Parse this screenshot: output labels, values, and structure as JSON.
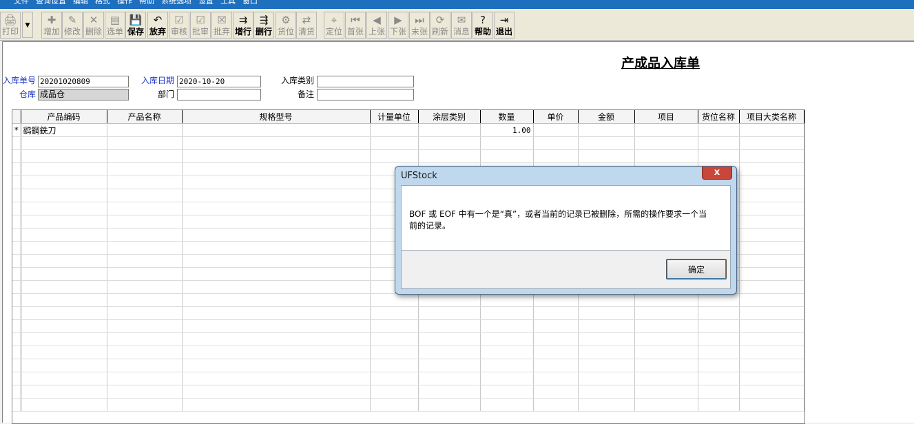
{
  "menubar": {
    "items": [
      "文件",
      "查询设置",
      "编辑",
      "格式",
      "操作",
      "帮助",
      "系统选项",
      "设置",
      "工具",
      "窗口"
    ]
  },
  "toolbar": {
    "buttons": [
      {
        "label": "打印",
        "icon": "🖨",
        "enabled": false
      },
      {
        "label": "增加",
        "icon": "✚",
        "enabled": false
      },
      {
        "label": "修改",
        "icon": "✎",
        "enabled": false
      },
      {
        "label": "删除",
        "icon": "✕",
        "enabled": false
      },
      {
        "label": "选单",
        "icon": "▤",
        "enabled": false
      },
      {
        "label": "保存",
        "icon": "💾",
        "enabled": true
      },
      {
        "label": "放弃",
        "icon": "↶",
        "enabled": true
      },
      {
        "label": "审核",
        "icon": "☑",
        "enabled": false
      },
      {
        "label": "批审",
        "icon": "☑",
        "enabled": false
      },
      {
        "label": "批弃",
        "icon": "☒",
        "enabled": false
      },
      {
        "label": "增行",
        "icon": "⇉",
        "enabled": true
      },
      {
        "label": "删行",
        "icon": "⇶",
        "enabled": true
      },
      {
        "label": "货位",
        "icon": "⚙",
        "enabled": false
      },
      {
        "label": "清货",
        "icon": "⇄",
        "enabled": false
      },
      {
        "label": "定位",
        "icon": "⌖",
        "enabled": false
      },
      {
        "label": "首张",
        "icon": "⏮",
        "enabled": false
      },
      {
        "label": "上张",
        "icon": "◀",
        "enabled": false
      },
      {
        "label": "下张",
        "icon": "▶",
        "enabled": false
      },
      {
        "label": "末张",
        "icon": "⏭",
        "enabled": false
      },
      {
        "label": "刷新",
        "icon": "⟳",
        "enabled": false
      },
      {
        "label": "消息",
        "icon": "✉",
        "enabled": false
      },
      {
        "label": "帮助",
        "icon": "?",
        "enabled": true
      },
      {
        "label": "退出",
        "icon": "⇥",
        "enabled": true
      }
    ]
  },
  "form": {
    "title": "产成品入库单",
    "receipt_no_label": "入库单号",
    "receipt_no": "20201020809",
    "date_label": "入库日期",
    "date": "2020-10-20",
    "category_label": "入库类别",
    "category": "",
    "warehouse_label": "仓库",
    "warehouse": "成品仓",
    "department_label": "部门",
    "department": "",
    "remark_label": "备注",
    "remark": ""
  },
  "grid": {
    "columns": [
      "产品编码",
      "产品名称",
      "规格型号",
      "计量单位",
      "涂层类别",
      "数量",
      "单价",
      "金额",
      "项目",
      "货位名称",
      "项目大类名称"
    ],
    "rows": [
      {
        "marker": "*",
        "cells": [
          "鹞鋼銑刀",
          "",
          "",
          "",
          "",
          "1.00",
          "",
          "",
          "",
          "",
          ""
        ]
      }
    ]
  },
  "dialog": {
    "title": "UFStock",
    "close_label": "x",
    "message": "BOF 或 EOF 中有一个是“真”，或者当前的记录已被删除，所需的操作要求一个当前的记录。",
    "ok_label": "确定"
  }
}
